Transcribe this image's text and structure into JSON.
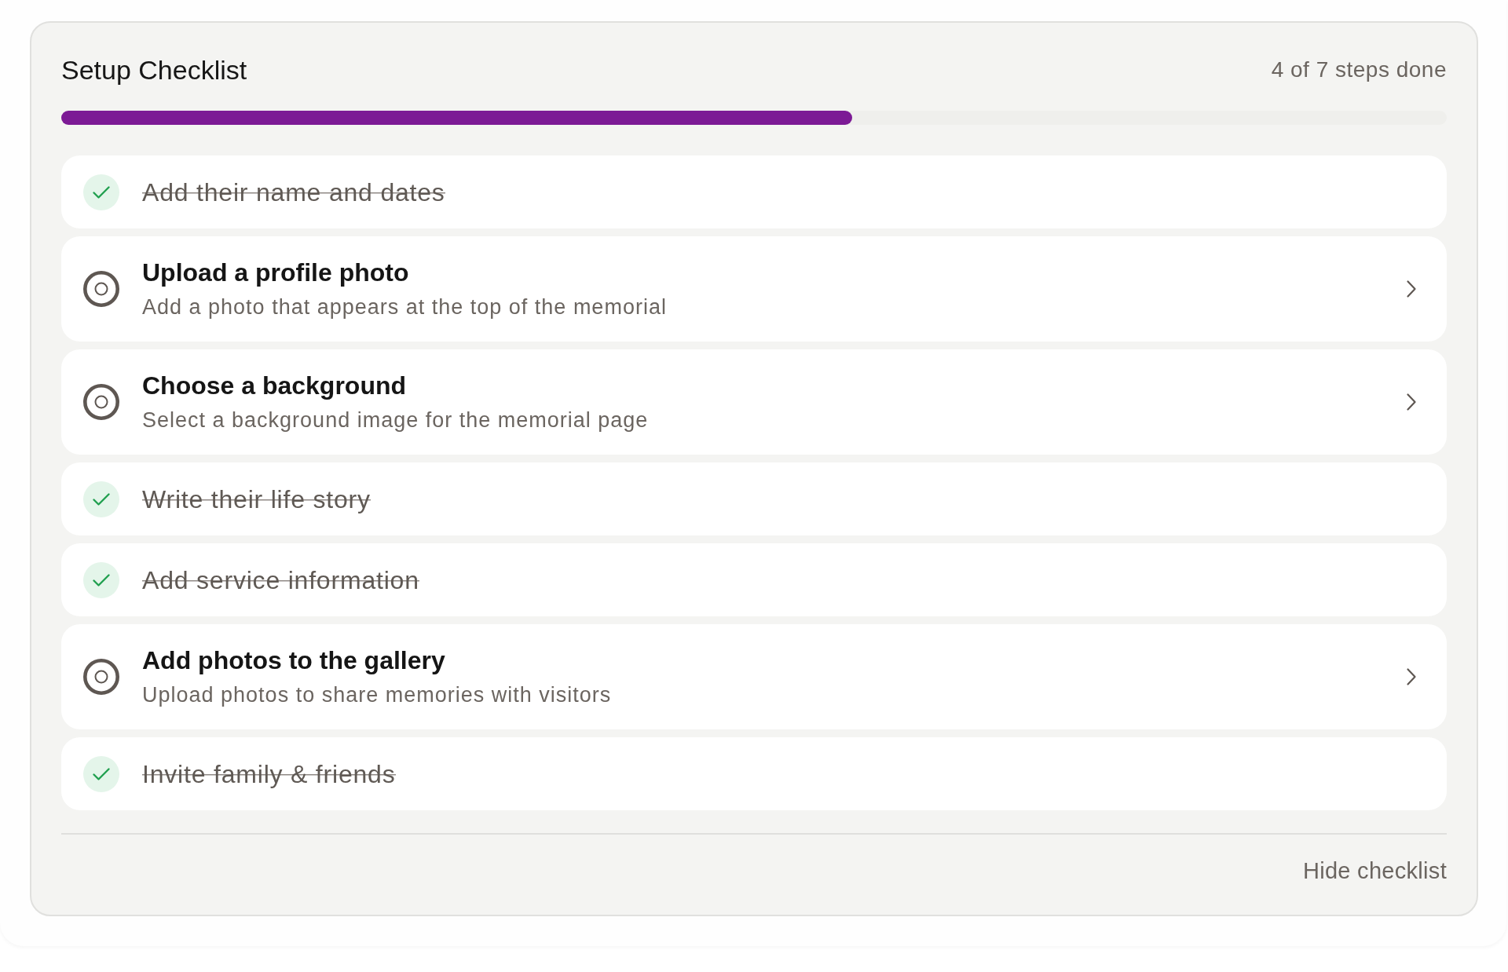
{
  "card": {
    "title": "Setup Checklist",
    "progress_text": "4 of 7 steps done",
    "progress": {
      "level": 0.571
    }
  },
  "steps": [
    {
      "title": "Add their name and dates",
      "done": true
    },
    {
      "title": "Upload a profile photo",
      "description": "Add a photo that appears at the top of the memorial",
      "done": false
    },
    {
      "title": "Choose a background",
      "description": "Select a background image for the memorial page",
      "done": false
    },
    {
      "title": "Write their life story",
      "done": true
    },
    {
      "title": "Add service information",
      "done": true
    },
    {
      "title": "Add photos to the gallery",
      "description": "Upload photos to share memories with visitors",
      "done": false
    },
    {
      "title": "Invite family & friends",
      "done": true
    }
  ],
  "footer": {
    "hide_label": "Hide checklist"
  }
}
